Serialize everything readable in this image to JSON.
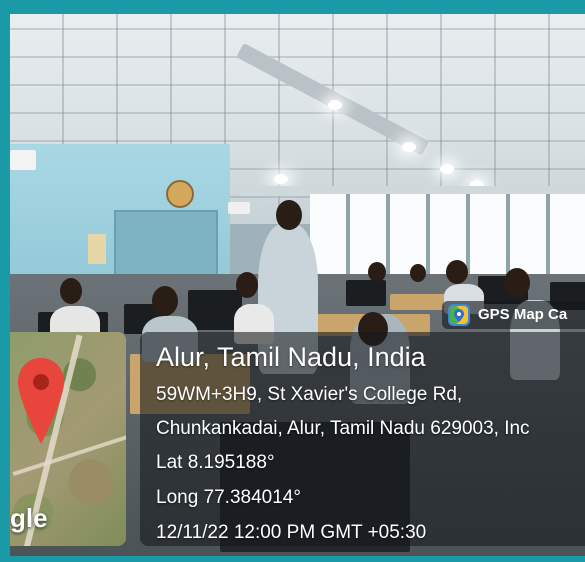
{
  "overlay": {
    "place": "Alur, Tamil Nadu, India",
    "address_line1": "59WM+3H9, St Xavier's College Rd,",
    "address_line2": "Chunkankadai, Alur, Tamil Nadu 629003, Inc",
    "latitude": "Lat 8.195188°",
    "longitude": "Long 77.384014°",
    "timestamp": "12/11/22 12:00 PM GMT +05:30"
  },
  "badge": {
    "label": "GPS Map Ca",
    "icon": "gps-map-camera-app-icon"
  },
  "map": {
    "logo_text": "gle",
    "pin_icon": "location-pin-icon",
    "pin_color": "#e8453c"
  },
  "colors": {
    "border": "#1a9aa6",
    "overlay_bg": "rgba(20,24,28,0.58)",
    "text": "#ffffff"
  }
}
